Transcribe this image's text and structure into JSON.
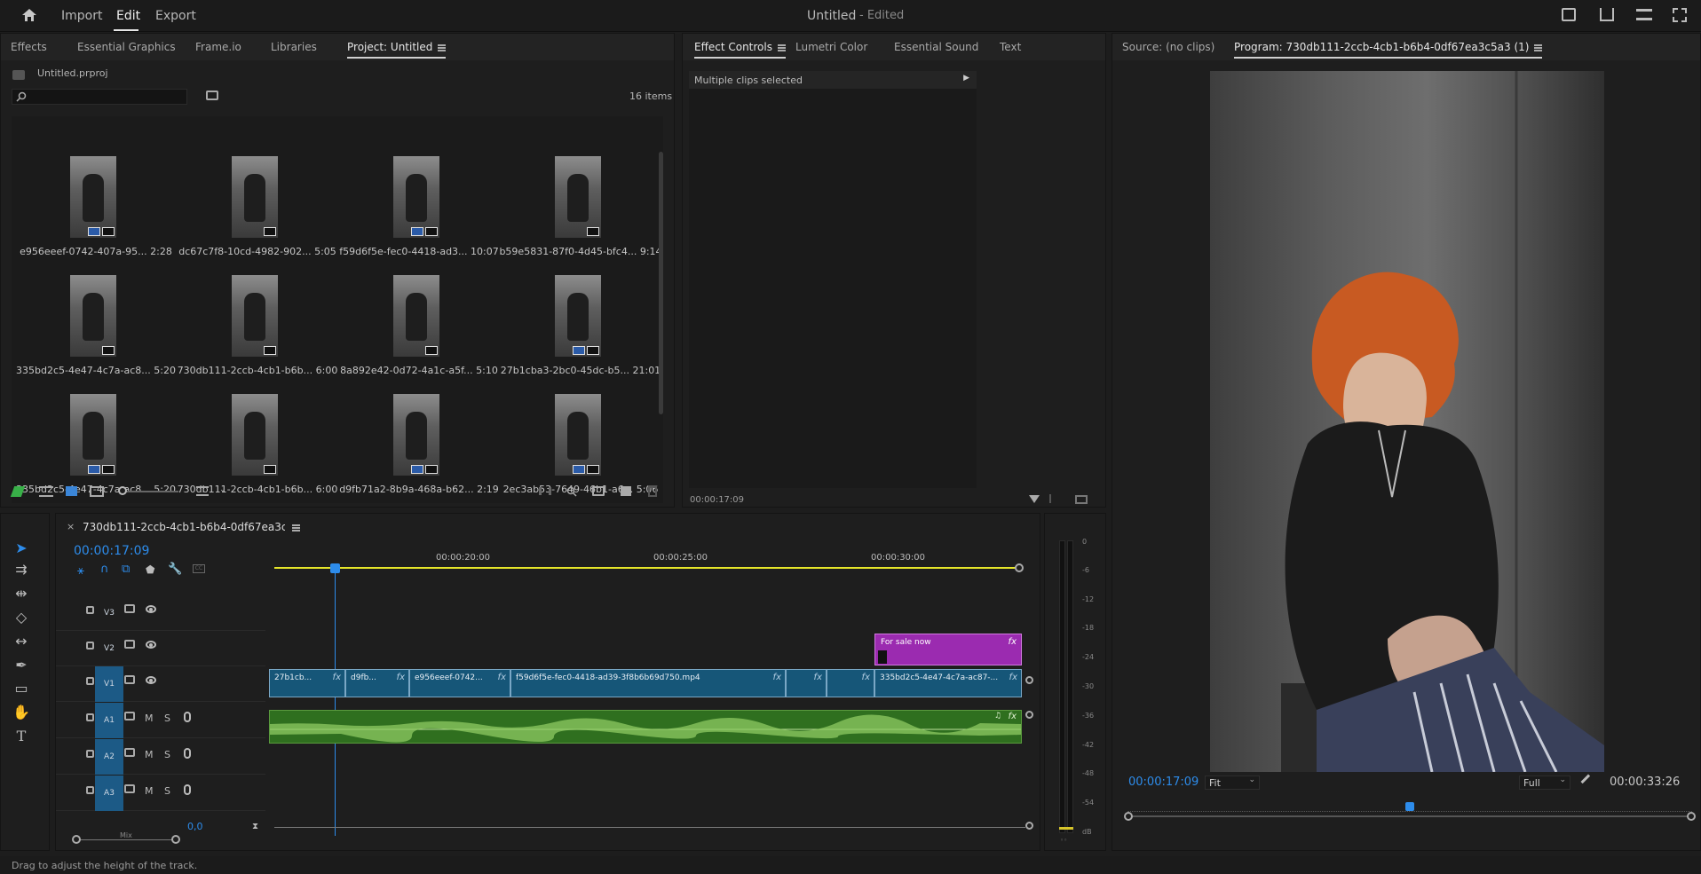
{
  "app": {
    "title": "Untitled",
    "title_suffix": "- Edited",
    "nav": [
      "Import",
      "Edit",
      "Export"
    ],
    "status_bar": "Drag to adjust the height of the track."
  },
  "project_panel": {
    "tabs": [
      "Effects",
      "Essential Graphics",
      "Frame.io",
      "Libraries",
      "Project: Untitled"
    ],
    "active_tab": "Project: Untitled",
    "file_name": "Untitled.prproj",
    "search_placeholder": "",
    "item_count": "16 items",
    "items": [
      {
        "name": "e956eeef-0742-407a-95...",
        "duration": "2:28"
      },
      {
        "name": "dc67c7f8-10cd-4982-902...",
        "duration": "5:05"
      },
      {
        "name": "f59d6f5e-fec0-4418-ad3...",
        "duration": "10:07"
      },
      {
        "name": "b59e5831-87f0-4d45-bfc4...",
        "duration": "9:14"
      },
      {
        "name": "335bd2c5-4e47-4c7a-ac8...",
        "duration": "5:20"
      },
      {
        "name": "730db111-2ccb-4cb1-b6b...",
        "duration": "6:00"
      },
      {
        "name": "8a892e42-0d72-4a1c-a5f...",
        "duration": "5:10"
      },
      {
        "name": "27b1cba3-2bc0-45dc-b5...",
        "duration": "21:01"
      },
      {
        "name": "335bd2c5-4e47-4c7a-ac8...",
        "duration": "5:20"
      },
      {
        "name": "730db111-2ccb-4cb1-b6b...",
        "duration": "6:00"
      },
      {
        "name": "d9fb71a2-8b9a-468a-b62...",
        "duration": "2:19"
      },
      {
        "name": "2ec3ab53-7649-46b1-a6...",
        "duration": "5:06"
      }
    ]
  },
  "effect_panel": {
    "tabs": [
      "Effect Controls",
      "Lumetri Color",
      "Essential Sound",
      "Text"
    ],
    "active_tab": "Effect Controls",
    "header": "Multiple clips selected",
    "timecode": "00:00:17:09"
  },
  "monitor": {
    "source_tab": "Source: (no clips)",
    "program_tab": "Program: 730db111-2ccb-4cb1-b6b4-0df67ea3c5a3 (1)",
    "current_time": "00:00:17:09",
    "zoom": "Fit",
    "resolution": "Full",
    "duration": "00:00:33:26",
    "playhead_fraction": 0.5
  },
  "timeline": {
    "sequence_name": "730db111-2ccb-4cb1-b6b4-0df67ea3c5a3 (1)",
    "current_time": "00:00:17:09",
    "ruler": [
      "00:00:20:00",
      "00:00:25:00",
      "00:00:30:00"
    ],
    "tracks_video": [
      "V3",
      "V2",
      "V1"
    ],
    "tracks_audio": [
      "A1",
      "A2",
      "A3"
    ],
    "audio_buttons": [
      "M",
      "S"
    ],
    "mix_value": "0,0",
    "mix_label": "Mix",
    "title_clip": "For sale now",
    "clips_v1": [
      "27b1cb...",
      "d9fb...",
      "e956eeef-0742...",
      "f59d6f5e-fec0-4418-ad39-3f8b6b69d750.mp4",
      "",
      "",
      "335bd2c5-4e47-4c7a-ac87-..."
    ],
    "fx": "fx"
  },
  "audio_meter": {
    "ticks": [
      "0",
      "-6",
      "-12",
      "-18",
      "-24",
      "-30",
      "-36",
      "-42",
      "-48",
      "-54",
      "dB"
    ]
  },
  "colors": {
    "accent_blue": "#2d8ceb",
    "clip_blue": "#165678",
    "title_purple": "#9b2bb0",
    "audio_green": "#2f6f1f"
  }
}
